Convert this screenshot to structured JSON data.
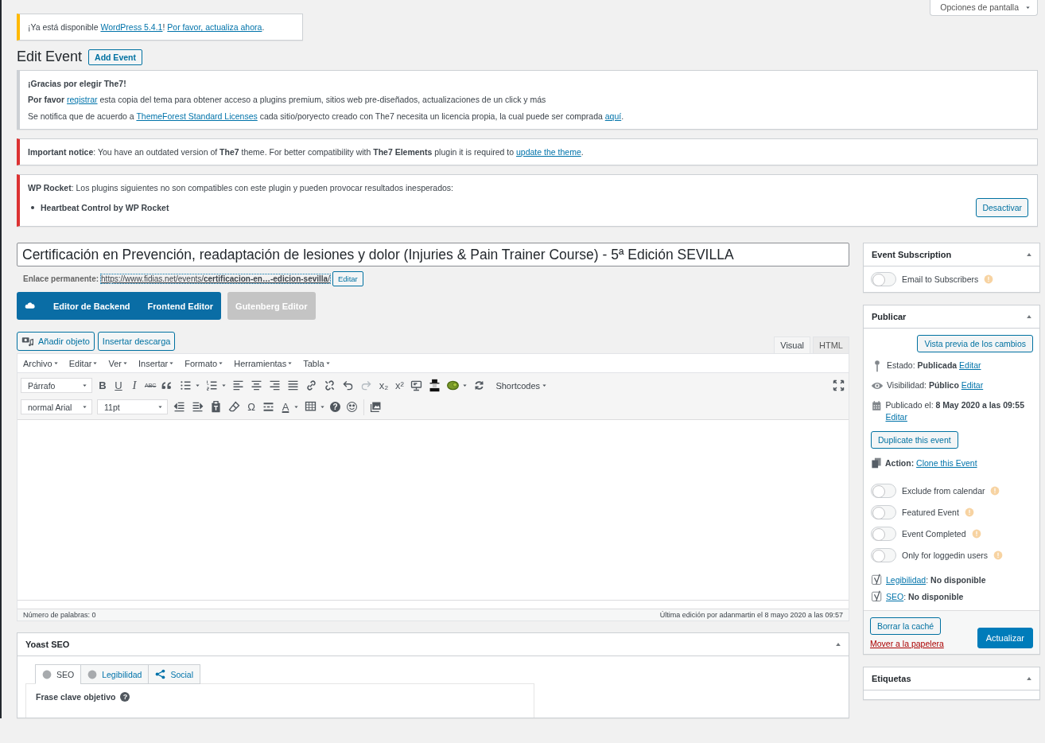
{
  "screen_options": {
    "label": "Opciones de pantalla"
  },
  "update_notice": {
    "kind": "update",
    "paragraphs": [
      {
        "kind": "text",
        "parts": [
          {
            "text": "¡Ya está disponible "
          },
          {
            "link": "WordPress 5.4.1"
          },
          {
            "text": "! "
          },
          {
            "link": "Por favor, actualiza ahora"
          },
          {
            "text": "."
          }
        ]
      }
    ]
  },
  "heading": {
    "title": "Edit Event",
    "add_button": "Add Event"
  },
  "notices": [
    {
      "kind": "info",
      "paragraphs": [
        {
          "kind": "title",
          "parts": [
            {
              "text": "¡Gracias por elegir The7!"
            }
          ]
        },
        {
          "kind": "text",
          "parts": [
            {
              "text": "**Por favor** "
            },
            {
              "link": "registrar"
            },
            {
              "text": " esta copia del tema para obtener acceso a plugins premium, sitios web pre-diseñados, actualizaciones de un click y más"
            }
          ]
        },
        {
          "kind": "text",
          "parts": [
            {
              "text": "Se notifica que de acuerdo a "
            },
            {
              "link": "ThemeForest Standard Licenses"
            },
            {
              "text": " cada sitio/poryecto creado con The7 necesita un licencia propia, la cual puede ser comprada "
            },
            {
              "link": "aquí"
            },
            {
              "text": "."
            }
          ]
        }
      ]
    },
    {
      "kind": "error",
      "paragraphs": [
        {
          "kind": "text",
          "parts": [
            {
              "text": "**Important notice**: You have an outdated version of **The7** theme. For better compatibility with **The7 Elements** plugin it is required to "
            },
            {
              "link": "update the theme"
            },
            {
              "text": "."
            }
          ]
        }
      ]
    },
    {
      "kind": "error",
      "paragraphs": [
        {
          "kind": "text",
          "parts": [
            {
              "text": "**WP Rocket**: Los plugins siguientes no son compatibles con este plugin y pueden provocar resultados inesperados:"
            }
          ]
        }
      ],
      "list": [
        "Heartbeat Control by WP Rocket"
      ],
      "button": "Desactivar"
    }
  ],
  "post_title": {
    "value": "Certificación en Prevención, readaptación de lesiones y dolor (Injuries & Pain Trainer Course) - 5ª Edición SEVILLA"
  },
  "permalink": {
    "label": "Enlace permanente:",
    "url": "https://www.fidias.net/events/**certificacion-en…-edicion-sevilla**/",
    "edit": "Editar"
  },
  "builder": {
    "backend": "Editor de Backend",
    "frontend": "Frontend Editor",
    "gutenberg": "Gutenberg Editor"
  },
  "editor": {
    "media_buttons": [
      {
        "label": "Añadir objeto",
        "kind": "media"
      },
      {
        "label": "Insertar descarga",
        "kind": "plain"
      }
    ],
    "tabs": [
      {
        "label": "Visual",
        "selected": true
      },
      {
        "label": "HTML",
        "selected": false
      }
    ],
    "menubar": [
      "Archivo",
      "Editar",
      "Ver",
      "Insertar",
      "Formato",
      "Herramientas",
      "Tabla"
    ],
    "format_select": "Párrafo",
    "font_select": "normal Arial",
    "size_select": "11pt",
    "shortcodes": "Shortcodes",
    "glyphs": {
      "bold": "B",
      "underline": "U",
      "italic": "I",
      "strike": "ABC",
      "subscript": "x₂",
      "superscript": "x²",
      "omega": "Ω",
      "text_color": "A",
      "help": "?"
    },
    "word_count": "Número de palabras: 0",
    "last_edit": "Última edición por adanmartin el 8 mayo 2020 a las 09:57"
  },
  "yoast": {
    "title": "Yoast SEO",
    "tabs": [
      {
        "label": "SEO",
        "selected": true,
        "kind": "dot"
      },
      {
        "label": "Legibilidad",
        "selected": false,
        "kind": "dot"
      },
      {
        "label": "Social",
        "selected": false,
        "kind": "share"
      }
    ],
    "field_label": "Frase clave objetivo",
    "help": "?"
  },
  "sidebar": {
    "subscription": {
      "title": "Event Subscription",
      "toggles": [
        {
          "label": "Email to Subscribers",
          "on": false
        }
      ]
    },
    "publish": {
      "title": "Publicar",
      "preview": "Vista previa de los cambios",
      "meta_rows": [
        {
          "kind": "status",
          "parts": [
            {
              "text": "Estado: **Publicada** "
            },
            {
              "link": "Editar"
            }
          ]
        },
        {
          "kind": "visibility",
          "parts": [
            {
              "text": "Visibilidad: **Público** "
            },
            {
              "link": "Editar"
            }
          ]
        },
        {
          "kind": "date",
          "parts": [
            {
              "text": "Publicado el: **8 May 2020 a las 09:55** "
            },
            {
              "link": "Editar"
            }
          ]
        }
      ],
      "duplicate": "Duplicate this event",
      "action": {
        "parts": [
          {
            "text": "**Action:** "
          },
          {
            "link": "Clone this Event"
          }
        ]
      },
      "toggles": [
        {
          "label": "Exclude from calendar",
          "on": false
        },
        {
          "label": "Featured Event",
          "on": false
        },
        {
          "label": "Event Completed",
          "on": false
        },
        {
          "label": "Only for loggedin users",
          "on": false
        }
      ],
      "seo_rows": [
        {
          "parts": [
            {
              "link": "Legibilidad"
            },
            {
              "text": ": **No disponible**"
            }
          ]
        },
        {
          "parts": [
            {
              "link": "SEO"
            },
            {
              "text": ": **No disponible**"
            }
          ]
        }
      ],
      "clear_cache": "Borrar la caché",
      "trash": "Mover a la papelera",
      "update": "Actualizar"
    },
    "tags": {
      "title": "Etiquetas"
    }
  }
}
